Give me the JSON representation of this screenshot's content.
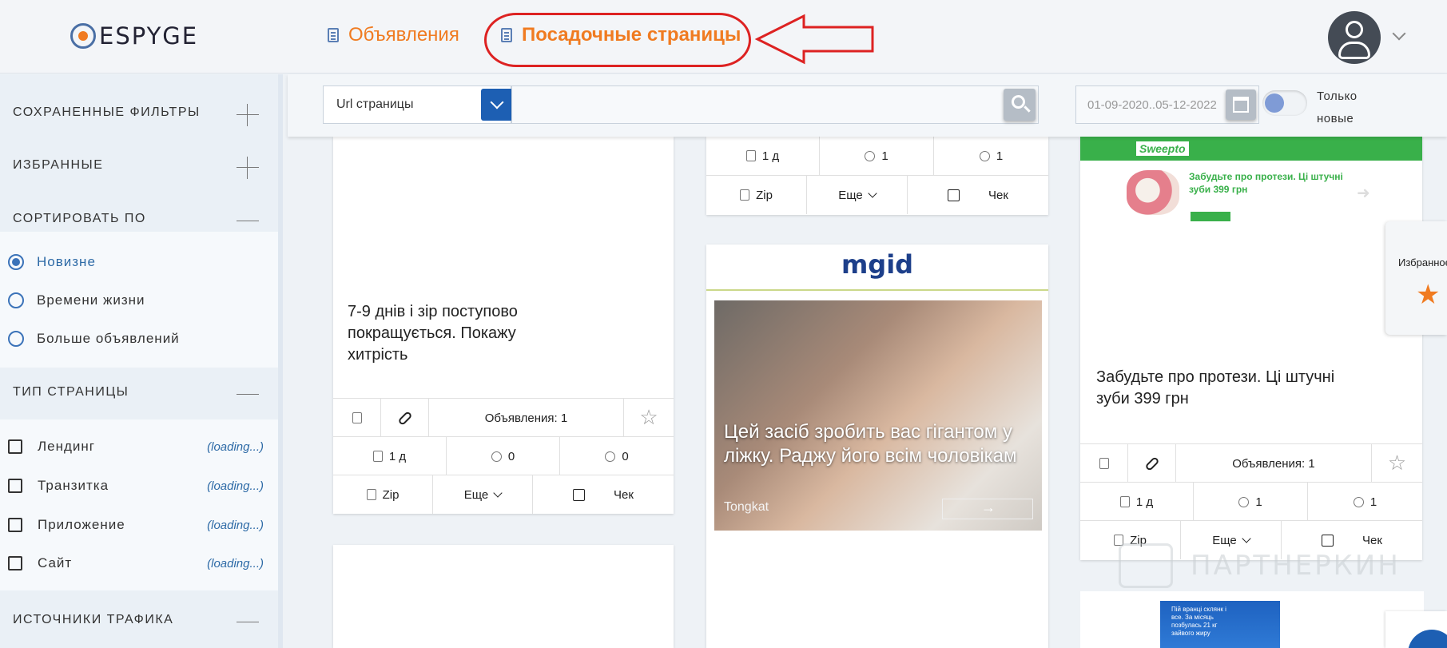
{
  "app": {
    "logo_text": "ESPYGE"
  },
  "nav": {
    "ads": "Объявления",
    "landing_pages": "Посадочные страницы"
  },
  "sidebar": {
    "saved_filters": "СОХРАНЕННЫЕ ФИЛЬТРЫ",
    "favorites": "ИЗБРАННЫЕ",
    "sort_by": "СОРТИРОВАТЬ ПО",
    "sort_options": [
      "Новизне",
      "Времени жизни",
      "Больше объявлений"
    ],
    "page_type": "ТИП СТРАНИЦЫ",
    "page_types": [
      {
        "label": "Лендинг",
        "count": "(loading...)"
      },
      {
        "label": "Транзитка",
        "count": "(loading...)"
      },
      {
        "label": "Приложение",
        "count": "(loading...)"
      },
      {
        "label": "Сайт",
        "count": "(loading...)"
      }
    ],
    "traffic_sources": "ИСТОЧНИКИ ТРАФИКА"
  },
  "filter": {
    "select_value": "Url страницы",
    "date_range": "01-09-2020..05-12-2022",
    "toggle_label": "Только новые"
  },
  "cards": {
    "card1_text": "7-9 днів і зір поступово покращується. Покажу хитрість",
    "card1_ads": "Объявления: 1",
    "card1_age": "1 д",
    "card1_shares": "0",
    "card1_geo": "0",
    "card2_age": "1 д",
    "card2_shares": "1",
    "card2_geo": "1",
    "card2_logo": "mgid",
    "card2_caption": "Цей засіб зробить вас гігантом у ліжку. Раджу його всім чоловікам",
    "card2_brand": "Tongkat",
    "card3_logo": "Sweepto",
    "card3_heading": "Забудьте про протези. Ці штучні зуби 399 грн",
    "card3_text": "Забудьте про протези. Ці штучні зуби 399 грн",
    "card3_ads": "Объявления: 1",
    "card3_age": "1 д",
    "card3_shares": "1",
    "card3_geo": "1",
    "card4_text": "Пій вранці склянк і все. За місяць позбулась 21 кг зайвого жиру",
    "zip": "Zip",
    "more": "Еще",
    "check": "Чек"
  },
  "fav_tab": {
    "label": "Избранное"
  },
  "watermark": "ПАРТНЕРКИН"
}
